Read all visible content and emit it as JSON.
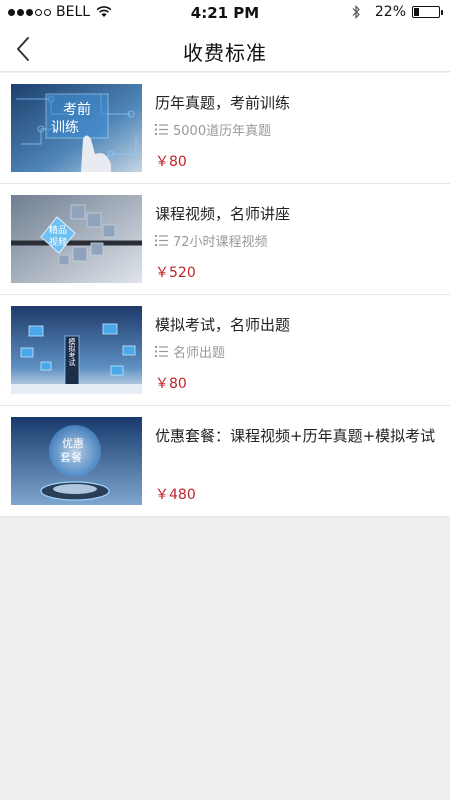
{
  "status_bar": {
    "carrier": "BELL",
    "time": "4:21 PM",
    "battery_percent": "22%",
    "battery_level": 0.22,
    "signal_bars": 3,
    "signal_total": 5
  },
  "nav": {
    "title": "收费标准",
    "back_icon": "chevron-left-icon"
  },
  "items": [
    {
      "title": "历年真题，考前训练",
      "meta": "5000道历年真题",
      "price": "￥80",
      "thumb_text": [
        "考前",
        "训练"
      ]
    },
    {
      "title": "课程视频，名师讲座",
      "meta": "72小时课程视频",
      "price": "￥520",
      "thumb_text": [
        "精品",
        "视频"
      ]
    },
    {
      "title": "模拟考试，名师出题",
      "meta": "名师出题",
      "price": "￥80",
      "thumb_text": [
        "模拟考试"
      ]
    },
    {
      "title": "优惠套餐：课程视频+历年真题+模拟考试",
      "meta": "",
      "price": "￥480",
      "thumb_text": [
        "优惠",
        "套餐"
      ]
    }
  ],
  "colors": {
    "price": "#c0242c",
    "background": "#f0eff0",
    "card": "#ffffff"
  }
}
